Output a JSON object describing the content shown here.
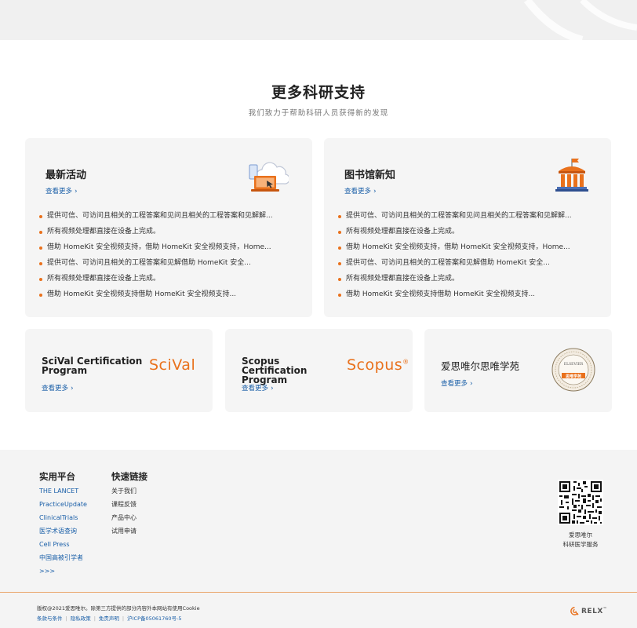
{
  "section": {
    "title": "更多科研支持",
    "subtitle": "我们致力于帮助科研人员获得新的发现"
  },
  "cards": [
    {
      "title": "最新活动",
      "more": "查看更多",
      "icon": "laptop-cloud-icon",
      "bullets": [
        "提供可信、可访问且相关的工程答案和见问且相关的工程答案和见解解...",
        "所有视频处理都直接在设备上完成。",
        "借助 HomeKit 安全视频支持，借助 HomeKit 安全视频支持，Home...",
        "提供可信、可访问且相关的工程答案和见解借助 HomeKit 安全...",
        "所有视频处理都直接在设备上完成。",
        "借助 HomeKit 安全视频支持借助 HomeKit 安全视频支持..."
      ]
    },
    {
      "title": "图书馆新知",
      "more": "查看更多",
      "icon": "library-building-icon",
      "bullets": [
        "提供可信、可访问且相关的工程答案和见问且相关的工程答案和见解解...",
        "所有视频处理都直接在设备上完成。",
        "借助 HomeKit 安全视频支持，借助 HomeKit 安全视频支持，Home...",
        "提供可信、可访问且相关的工程答案和见解借助 HomeKit 安全...",
        "所有视频处理都直接在设备上完成。",
        "借助 HomeKit 安全视频支持借助 HomeKit 安全视频支持..."
      ]
    }
  ],
  "small_cards": [
    {
      "title": "SciVal Certification Program",
      "more": "查看更多",
      "logo": "SciVal"
    },
    {
      "title": "Scopus Certification Program",
      "more": "查看更多",
      "logo": "Scopus",
      "logo_mark": "®"
    },
    {
      "title": "爱思唯尔思唯学苑",
      "more": "查看更多",
      "seal_top": "ELSEVIER",
      "seal_main": "思唯学苑"
    }
  ],
  "footer": {
    "platforms_heading": "实用平台",
    "platforms": [
      "THE LANCET",
      "PracticeUpdate",
      "ClinicalTrials",
      "医学术语查询",
      "Cell Press",
      "中国高被引学者",
      ">>>"
    ],
    "quicklinks_heading": "快速链接",
    "quicklinks": [
      "关于我们",
      "课程反馈",
      "产品中心",
      "试用申请"
    ],
    "qr_caption_line1": "爱思唯尔",
    "qr_caption_line2": "科研医学服务",
    "copyright": "版权@2021爱思唯尔。除第三方提供的部分内容外本网站有使用Cookie",
    "legal": [
      "条款与条件",
      "隐私政策",
      "免责声明",
      "沪ICP备05061760号-5"
    ],
    "brand": "RELX",
    "brand_mark": "™"
  },
  "colors": {
    "accent": "#e9711c",
    "link": "#1a5fa8",
    "card_bg": "#f5f5f5",
    "footer_bg": "#f4f4f4"
  }
}
